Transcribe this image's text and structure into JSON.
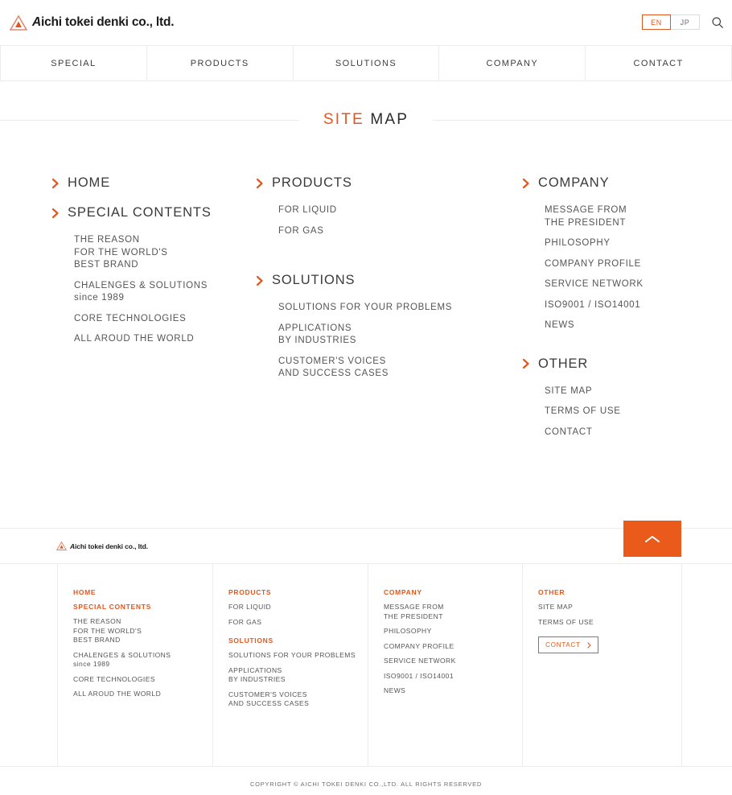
{
  "brand": {
    "logo_text": "Aichi tokei denki co., ltd.",
    "logo_initial": "A",
    "logo_rest": "ichi tokei denki co., ltd.",
    "accent_color": "#e2571e",
    "accent_solid": "#ea5a1b",
    "text_color": "#4a4a4a"
  },
  "header": {
    "lang": {
      "en": "EN",
      "jp": "JP",
      "active": "EN"
    },
    "search_icon": "search-icon"
  },
  "gnav": {
    "items": [
      {
        "label": "SPECIAL"
      },
      {
        "label": "PRODUCTS"
      },
      {
        "label": "SOLUTIONS"
      },
      {
        "label": "COMPANY"
      },
      {
        "label": "CONTACT"
      }
    ]
  },
  "page": {
    "title_part1": "SITE",
    "title_part2": "MAP"
  },
  "sitemap": {
    "col1": {
      "home": {
        "label": "HOME"
      },
      "special": {
        "label": "SPECIAL CONTENTS",
        "links": [
          {
            "line1": "THE REASON",
            "line2": "FOR THE WORLD'S",
            "line3": "BEST BRAND"
          },
          {
            "line1": "CHALENGES & SOLUTIONS",
            "line2": "since 1989"
          },
          {
            "line1": "CORE TECHNOLOGIES"
          },
          {
            "line1": "ALL AROUD THE WORLD"
          }
        ]
      }
    },
    "col2": {
      "products": {
        "label": "PRODUCTS",
        "links": [
          {
            "line1": "FOR LIQUID"
          },
          {
            "line1": "FOR GAS"
          }
        ]
      },
      "solutions": {
        "label": "SOLUTIONS",
        "links": [
          {
            "line1": "SOLUTIONS FOR YOUR PROBLEMS"
          },
          {
            "line1": "APPLICATIONS",
            "line2": "BY INDUSTRIES"
          },
          {
            "line1": "CUSTOMER'S VOICES",
            "line2": "AND SUCCESS CASES"
          }
        ]
      }
    },
    "col3": {
      "company": {
        "label": "COMPANY",
        "links": [
          {
            "line1": "MESSAGE FROM",
            "line2": "THE PRESIDENT"
          },
          {
            "line1": "PHILOSOPHY"
          },
          {
            "line1": "COMPANY PROFILE"
          },
          {
            "line1": "SERVICE NETWORK"
          },
          {
            "line1": "ISO9001 / ISO14001"
          },
          {
            "line1": "NEWS"
          }
        ]
      },
      "other": {
        "label": "OTHER",
        "links": [
          {
            "line1": "SITE MAP"
          },
          {
            "line1": "TERMS OF USE"
          },
          {
            "line1": "CONTACT"
          }
        ]
      }
    }
  },
  "footer": {
    "to_top_icon": "chevron-up-icon",
    "col1": {
      "home": "HOME",
      "special": "SPECIAL CONTENTS",
      "links": [
        {
          "line1": "THE REASON",
          "line2": "FOR THE WORLD'S",
          "line3": "BEST BRAND"
        },
        {
          "line1": "CHALENGES & SOLUTIONS",
          "line2": "since 1989"
        },
        {
          "line1": "CORE TECHNOLOGIES"
        },
        {
          "line1": "ALL AROUD THE WORLD"
        }
      ]
    },
    "col2": {
      "products": "PRODUCTS",
      "product_links": [
        {
          "line1": "FOR LIQUID"
        },
        {
          "line1": "FOR GAS"
        }
      ],
      "solutions": "SOLUTIONS",
      "solution_links": [
        {
          "line1": "SOLUTIONS FOR YOUR PROBLEMS"
        },
        {
          "line1": "APPLICATIONS",
          "line2": "BY INDUSTRIES"
        },
        {
          "line1": "CUSTOMER'S VOICES",
          "line2": "AND SUCCESS CASES"
        }
      ]
    },
    "col3": {
      "company": "COMPANY",
      "links": [
        {
          "line1": "MESSAGE FROM",
          "line2": "THE PRESIDENT"
        },
        {
          "line1": "PHILOSOPHY"
        },
        {
          "line1": "COMPANY PROFILE"
        },
        {
          "line1": "SERVICE NETWORK"
        },
        {
          "line1": "ISO9001 / ISO14001"
        },
        {
          "line1": "NEWS"
        }
      ]
    },
    "col4": {
      "other": "OTHER",
      "links": [
        {
          "line1": "SITE MAP"
        },
        {
          "line1": "TERMS OF USE"
        }
      ],
      "contact_button": "CONTACT"
    },
    "copyright": "COPYRIGHT © AICHI TOKEI DENKI CO.,LTD. ALL RIGHTS RESERVED"
  }
}
